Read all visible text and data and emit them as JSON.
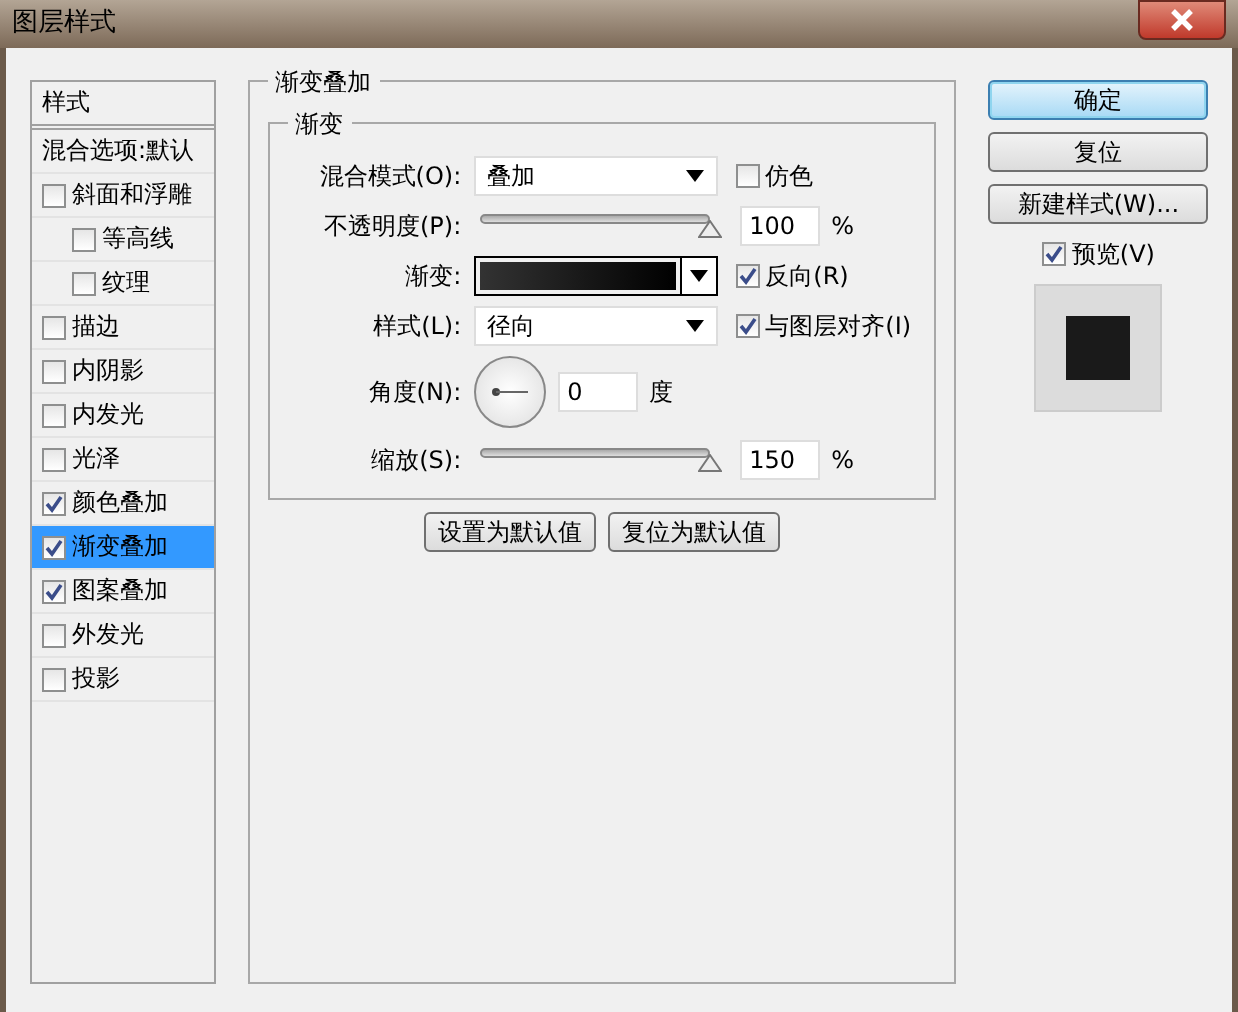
{
  "window": {
    "title": "图层样式"
  },
  "sidebar": {
    "items": [
      {
        "kind": "header",
        "label": "样式",
        "selected": false
      },
      {
        "kind": "option",
        "label": "混合选项:默认",
        "selected": false
      },
      {
        "kind": "effect",
        "label": "斜面和浮雕",
        "checked": false,
        "selected": false,
        "children": [
          {
            "kind": "effect",
            "label": "等高线",
            "checked": false,
            "selected": false
          },
          {
            "kind": "effect",
            "label": "纹理",
            "checked": false,
            "selected": false
          }
        ]
      },
      {
        "kind": "effect",
        "label": "描边",
        "checked": false,
        "selected": false
      },
      {
        "kind": "effect",
        "label": "内阴影",
        "checked": false,
        "selected": false
      },
      {
        "kind": "effect",
        "label": "内发光",
        "checked": false,
        "selected": false
      },
      {
        "kind": "effect",
        "label": "光泽",
        "checked": false,
        "selected": false
      },
      {
        "kind": "effect",
        "label": "颜色叠加",
        "checked": true,
        "selected": false
      },
      {
        "kind": "effect",
        "label": "渐变叠加",
        "checked": true,
        "selected": true
      },
      {
        "kind": "effect",
        "label": "图案叠加",
        "checked": true,
        "selected": false
      },
      {
        "kind": "effect",
        "label": "外发光",
        "checked": false,
        "selected": false
      },
      {
        "kind": "effect",
        "label": "投影",
        "checked": false,
        "selected": false
      }
    ]
  },
  "panel": {
    "group_title": "渐变叠加",
    "section_title": "渐变",
    "blend_mode": {
      "label": "混合模式(O):",
      "value": "叠加"
    },
    "dither": {
      "label": "仿色",
      "checked": false
    },
    "opacity": {
      "label": "不透明度(P):",
      "level": 1,
      "value": "100",
      "unit": "%"
    },
    "gradient": {
      "label": "渐变:"
    },
    "reverse": {
      "label": "反向(R)",
      "checked": true
    },
    "style": {
      "label": "样式(L):",
      "value": "径向"
    },
    "align": {
      "label": "与图层对齐(I)",
      "checked": true
    },
    "angle": {
      "label": "角度(N):",
      "value": "0",
      "unit": "度"
    },
    "scale": {
      "label": "缩放(S):",
      "level": 1,
      "value": "150",
      "unit": "%"
    },
    "buttons": [
      "设置为默认值",
      "复位为默认值"
    ]
  },
  "actions": {
    "buttons": [
      {
        "label": "确定",
        "default": true
      },
      {
        "label": "复位",
        "default": false
      },
      {
        "label": "新建样式(W)...",
        "default": false
      }
    ],
    "preview": {
      "label": "预览(V)",
      "checked": true
    }
  }
}
